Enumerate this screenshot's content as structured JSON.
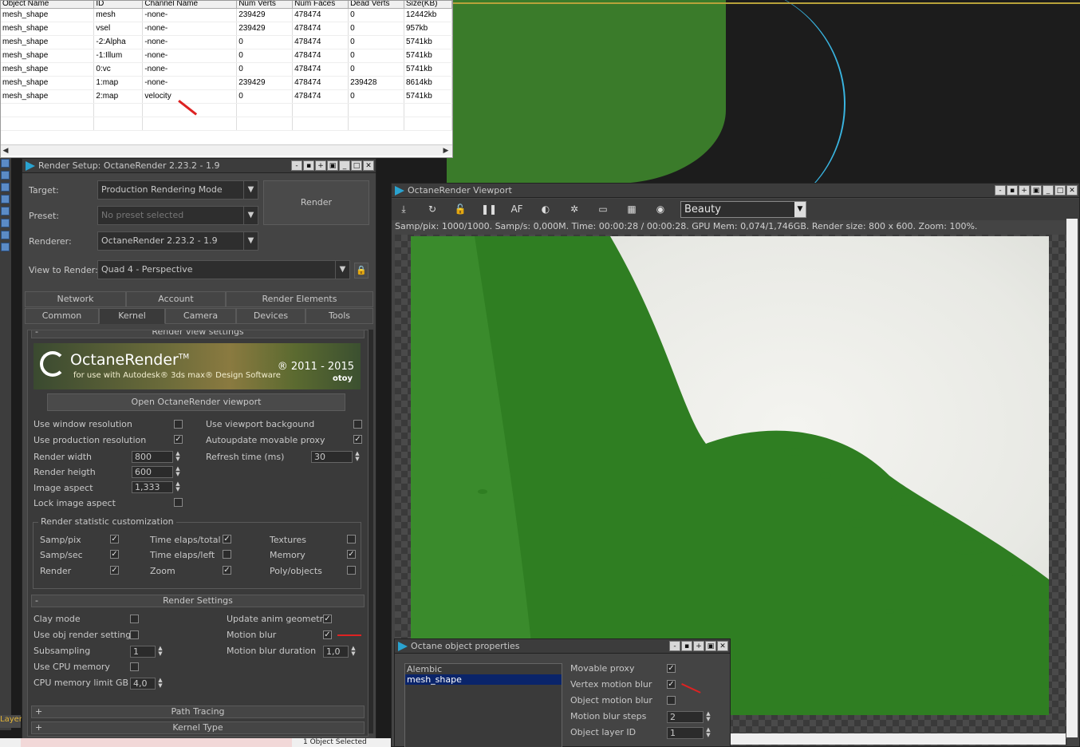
{
  "mesh_table": {
    "headers": [
      "Object Name",
      "ID",
      "Channel Name",
      "Num Verts",
      "Num Faces",
      "Dead Verts",
      "Size(KB)"
    ],
    "rows": [
      [
        "mesh_shape",
        "mesh",
        "-none-",
        "239429",
        "478474",
        "0",
        "12442kb"
      ],
      [
        "mesh_shape",
        "vsel",
        "-none-",
        "239429",
        "478474",
        "0",
        "957kb"
      ],
      [
        "mesh_shape",
        "-2:Alpha",
        "-none-",
        "0",
        "478474",
        "0",
        "5741kb"
      ],
      [
        "mesh_shape",
        "-1:Illum",
        "-none-",
        "0",
        "478474",
        "0",
        "5741kb"
      ],
      [
        "mesh_shape",
        "0:vc",
        "-none-",
        "0",
        "478474",
        "0",
        "5741kb"
      ],
      [
        "mesh_shape",
        "1:map",
        "-none-",
        "239429",
        "478474",
        "239428",
        "8614kb"
      ],
      [
        "mesh_shape",
        "2:map",
        "velocity",
        "0",
        "478474",
        "0",
        "5741kb"
      ]
    ]
  },
  "render_setup": {
    "title": "Render Setup: OctaneRender 2.23.2 - 1.9",
    "target_label": "Target:",
    "target_value": "Production Rendering Mode",
    "preset_label": "Preset:",
    "preset_value": "No preset selected",
    "renderer_label": "Renderer:",
    "renderer_value": "OctaneRender 2.23.2 - 1.9",
    "view_label": "View to Render:",
    "view_value": "Quad 4 - Perspective",
    "render_button": "Render",
    "tabs_row1": [
      "Network",
      "Account",
      "Render Elements"
    ],
    "tabs_row2": [
      "Common",
      "Kernel",
      "Camera",
      "Devices",
      "Tools"
    ],
    "active_tab": "Kernel",
    "rollup_render_view": "Render view settings",
    "banner_title": "OctaneRender",
    "banner_tm": "TM",
    "banner_sub": "for use with Autodesk® 3ds max® Design Software",
    "banner_years": "® 2011 - 2015",
    "banner_company": "otoy",
    "open_viewport_button": "Open OctaneRender viewport",
    "left_options": [
      {
        "label": "Use window resolution",
        "checked": false
      },
      {
        "label": "Use production resolution",
        "checked": true
      }
    ],
    "right_options": [
      {
        "label": "Use viewport backgound",
        "checked": false
      },
      {
        "label": "Autoupdate movable proxy",
        "checked": true
      }
    ],
    "render_width_label": "Render width",
    "render_width": "800",
    "render_height_label": "Render heigth",
    "render_height": "600",
    "image_aspect_label": "Image aspect",
    "image_aspect": "1,333",
    "lock_aspect_label": "Lock image aspect",
    "refresh_label": "Refresh time (ms)",
    "refresh_value": "30",
    "stat_group_label": "Render statistic customization",
    "stats": [
      {
        "label": "Samp/pix",
        "checked": true
      },
      {
        "label": "Time elaps/total",
        "checked": true
      },
      {
        "label": "Textures",
        "checked": false
      },
      {
        "label": "Samp/sec",
        "checked": true
      },
      {
        "label": "Time elaps/left",
        "checked": false
      },
      {
        "label": "Memory",
        "checked": true
      },
      {
        "label": "Render",
        "checked": true
      },
      {
        "label": "Zoom",
        "checked": true
      },
      {
        "label": "Poly/objects",
        "checked": false
      }
    ],
    "render_settings_header": "Render Settings",
    "clay_mode": "Clay mode",
    "use_obj_render": "Use obj render settings",
    "subsampling_label": "Subsampling",
    "subsampling": "1",
    "use_cpu_memory": "Use CPU memory",
    "cpu_limit_label": "CPU memory limit GB",
    "cpu_limit": "4,0",
    "update_anim": "Update anim geometry",
    "motion_blur": "Motion blur",
    "motion_blur_duration_label": "Motion blur duration",
    "motion_blur_duration": "1,0",
    "path_tracing": "Path Tracing",
    "kernel_type": "Kernel Type"
  },
  "octane_viewport": {
    "title": "OctaneRender Viewport",
    "pass": "Beauty",
    "status": "Samp/pix: 1000/1000.   Samp/s: 0,000M.   Time: 00:00:28 / 00:00:28.   GPU Mem: 0,074/1,746GB.   Render size: 800 x 600.   Zoom: 100%."
  },
  "object_properties": {
    "title": "Octane object properties",
    "list": [
      "Alembic",
      "mesh_shape"
    ],
    "selected": "mesh_shape",
    "movable_proxy": "Movable proxy",
    "vertex_motion_blur": "Vertex motion blur",
    "object_motion_blur": "Object motion blur",
    "motion_blur_steps_label": "Motion blur steps",
    "motion_blur_steps": "2",
    "object_layer_label": "Object layer ID",
    "object_layer": "1"
  },
  "status_bar": {
    "selection": "1 Object Selected",
    "layer_tab": "Layer"
  }
}
